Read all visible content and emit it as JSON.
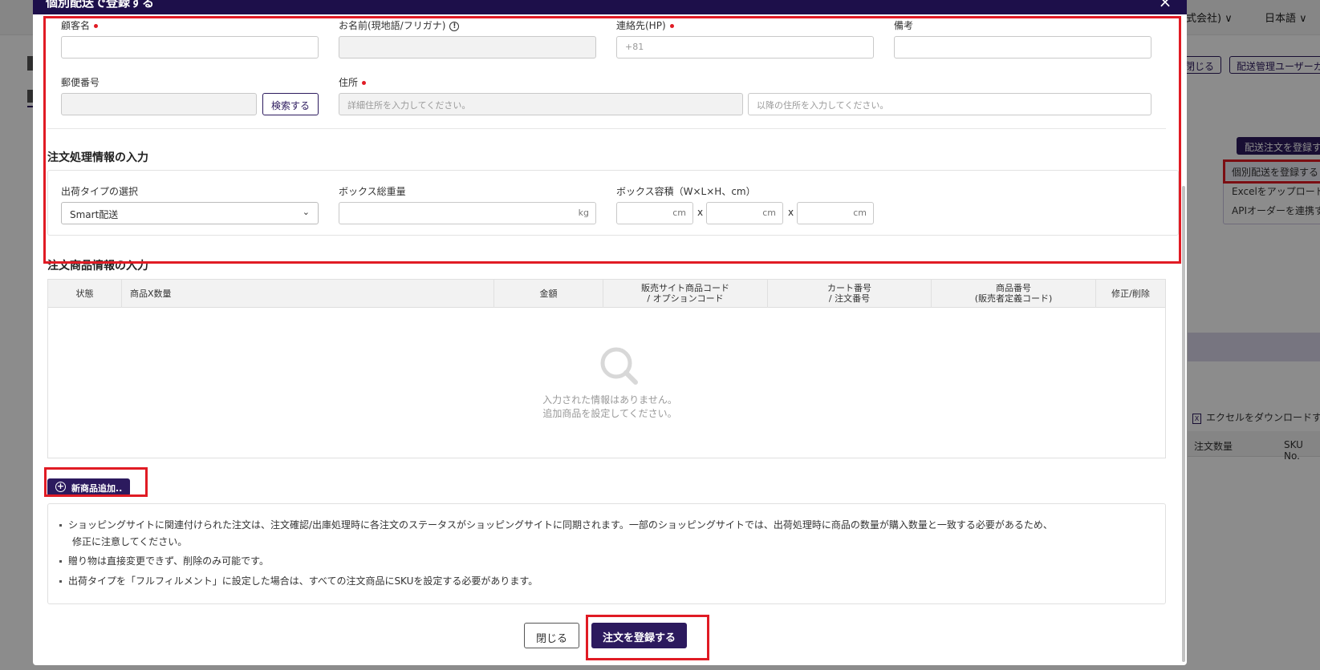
{
  "background": {
    "company_fragment": "式会社) ∨",
    "language": "日本語 ∨",
    "close_btn": "閉じる",
    "manager_btn": "配送管理ユーザーガ",
    "register_btn": "配送注文を登録す",
    "menu_items": [
      "個別配送を登録する",
      "Excelをアップロード",
      "APIオーダーを連携す"
    ],
    "excel_download": "エクセルをダウンロードす",
    "col_order_qty": "注文数量",
    "col_sku": "SKU No."
  },
  "modal": {
    "title": "個別配送で登録する",
    "close_icon": "×",
    "customer": {
      "name_label": "顧客名",
      "local_name_label": "お名前(現地語/フリガナ)",
      "local_name_info": "!",
      "phone_label": "連絡先(HP)",
      "phone_placeholder": "+81",
      "memo_label": "備考",
      "postal_label": "郵便番号",
      "search_btn": "検索する",
      "address_label": "住所",
      "address_placeholder": "詳細住所を入力してください。",
      "address2_placeholder": "以降の住所を入力してください。"
    },
    "processing": {
      "section_title": "注文処理情報の入力",
      "shipping_type_label": "出荷タイプの選択",
      "shipping_type_value": "Smart配送",
      "weight_label": "ボックス総重量",
      "weight_unit": "kg",
      "volume_label": "ボックス容積（W×L×H、cm）",
      "volume_unit": "cm",
      "times": "x"
    },
    "products": {
      "section_title": "注文商品情報の入力",
      "columns": [
        "状態",
        "商品X数量",
        "金額",
        "販売サイト商品コード\n/ オプションコード",
        "カート番号\n/ 注文番号",
        "商品番号\n(販売者定義コード)",
        "修正/削除"
      ],
      "empty_line1": "入力された情報はありません。",
      "empty_line2": "追加商品を設定してください。",
      "add_btn": "新商品追加.."
    },
    "notes": [
      "ショッピングサイトに関連付けられた注文は、注文確認/出庫処理時に各注文のステータスがショッピングサイトに同期されます。一部のショッピングサイトでは、出荷処理時に商品の数量が購入数量と一致する必要があるため、",
      "修正に注意してください。",
      "贈り物は直接変更できず、削除のみ可能です。",
      "出荷タイプを「フルフィルメント」に設定した場合は、すべての注文商品にSKUを設定する必要があります。"
    ],
    "footer": {
      "close_btn": "閉じる",
      "submit_btn": "注文を登録する"
    }
  },
  "colors": {
    "brand": "#2c1a5e",
    "header": "#1d0f4a",
    "highlight": "#e01b24",
    "required_dot": "#e01b24"
  }
}
